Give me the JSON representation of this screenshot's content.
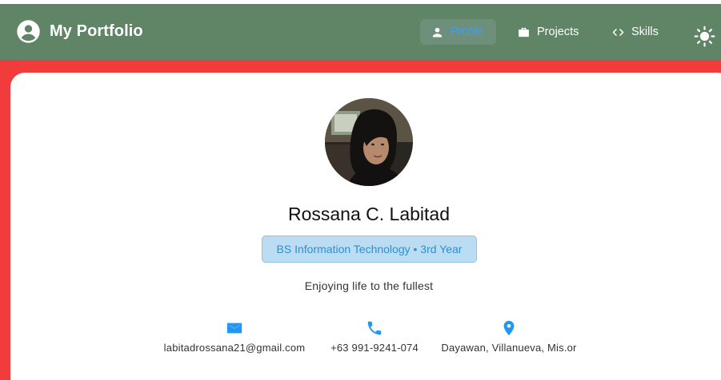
{
  "appbar": {
    "title": "My Portfolio",
    "brand_icon": "account-circle-icon",
    "nav": [
      {
        "label": "Profile",
        "icon": "person-icon",
        "active": true
      },
      {
        "label": "Projects",
        "icon": "briefcase-icon",
        "active": false
      },
      {
        "label": "Skills",
        "icon": "code-icon",
        "active": false
      }
    ],
    "theme_toggle_icon": "sun-icon"
  },
  "colors": {
    "appbar_bg": "#5f8466",
    "page_bg": "#f23c3c",
    "card_bg": "#ffffff",
    "accent": "#2196f3",
    "chip_bg": "#bcdcf3"
  },
  "profile": {
    "name": "Rossana C. Labitad",
    "program": "BS Information Technology • 3rd Year",
    "tagline": "Enjoying life to the fullest",
    "contacts": [
      {
        "icon": "email-icon",
        "text": "labitadrossana21@gmail.com"
      },
      {
        "icon": "phone-icon",
        "text": "+63 991-9241-074"
      },
      {
        "icon": "location-pin-icon",
        "text": "Dayawan, Villanueva, Mis.or"
      }
    ]
  }
}
